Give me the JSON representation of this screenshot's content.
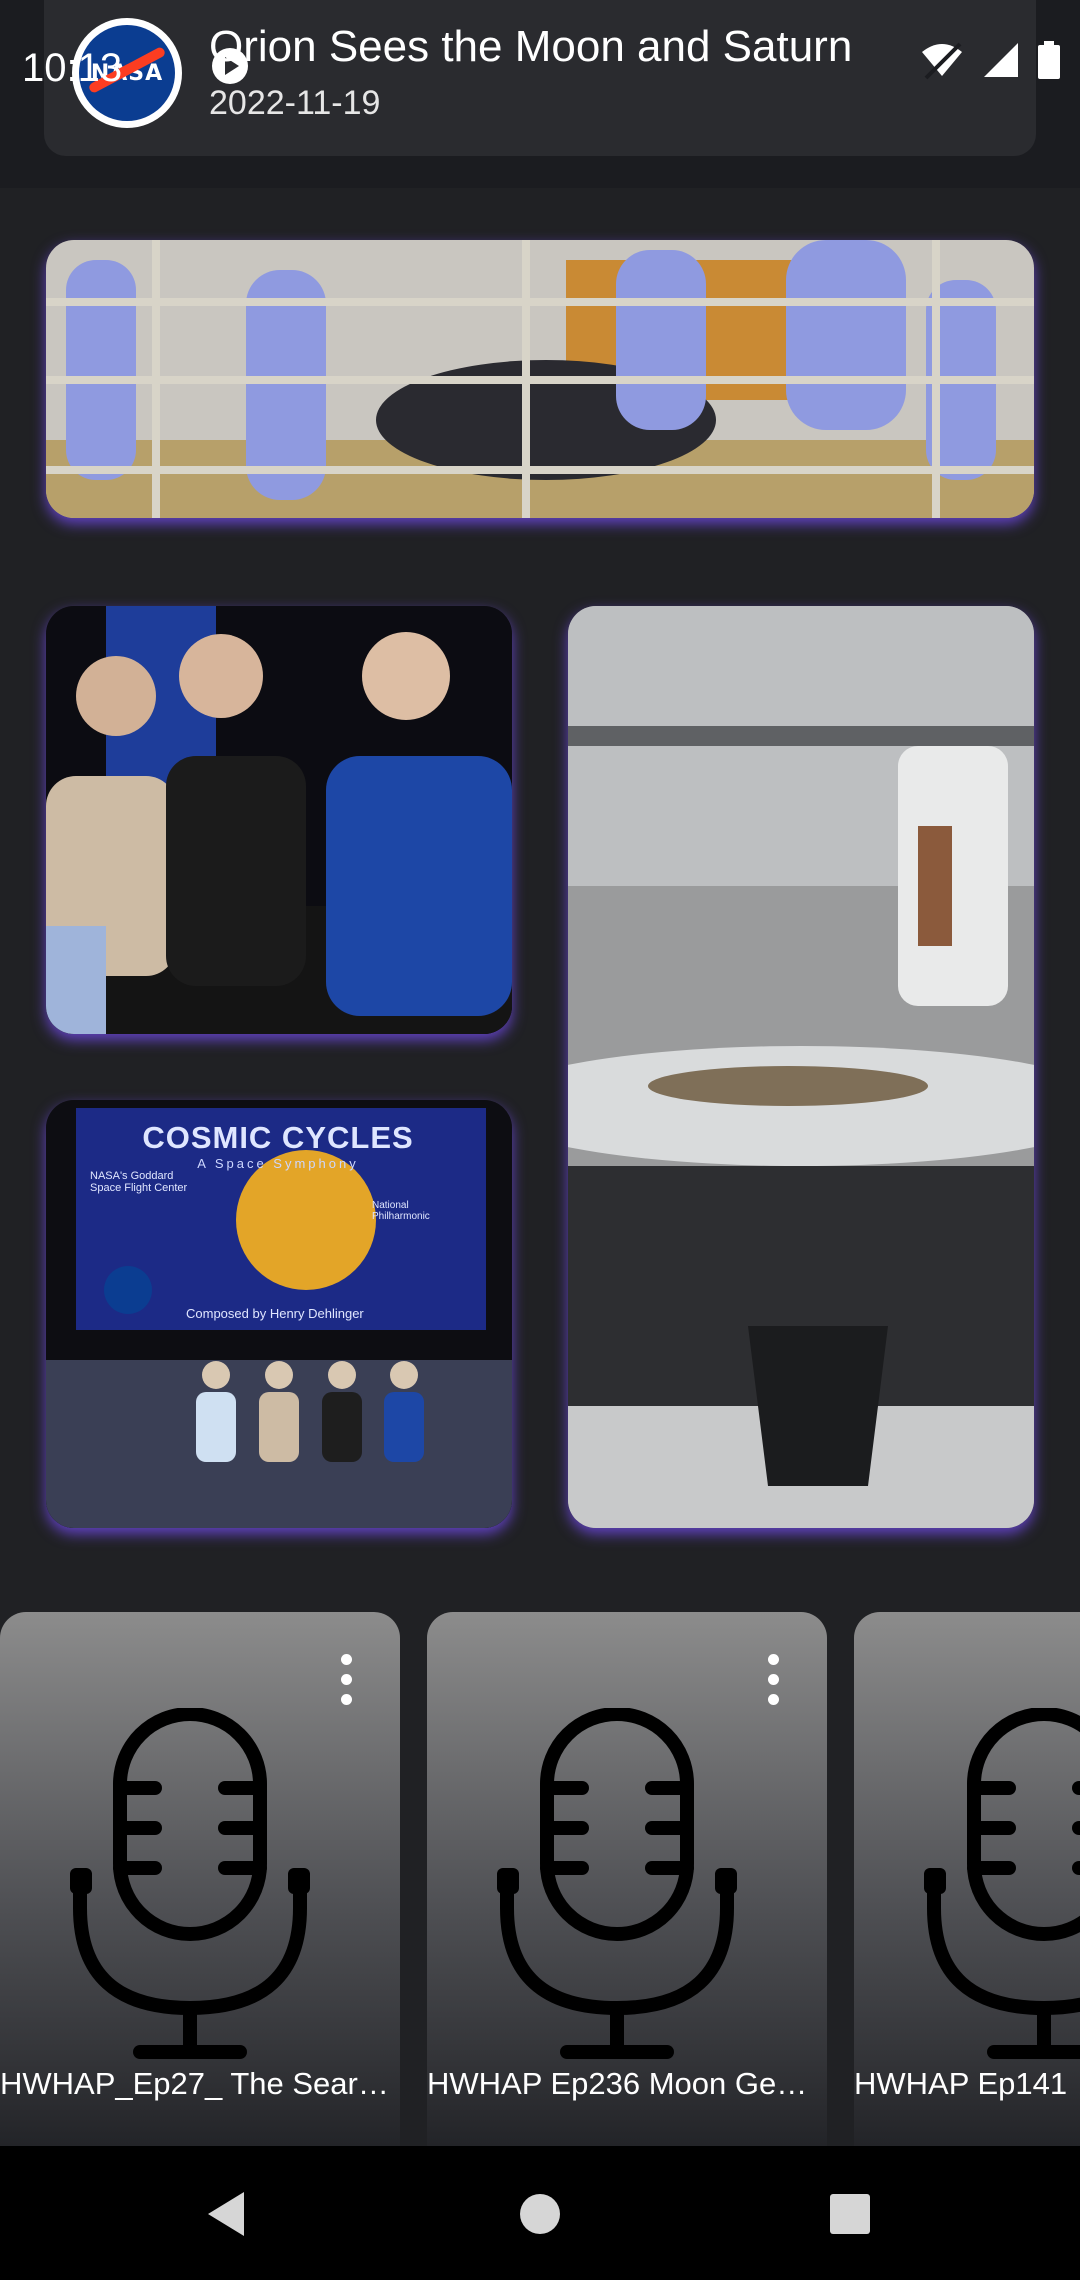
{
  "status_bar": {
    "time": "10:13"
  },
  "now_playing": {
    "logo": "NASA",
    "title": "Orion Sees the Moon and Saturn",
    "date": "2022-11-19"
  },
  "gallery": {
    "items": [
      {
        "name": "cleanroom-spacecraft-photo"
      },
      {
        "name": "panel-speakers-photo"
      },
      {
        "name": "instrument-closeup-photo"
      },
      {
        "name": "cosmic-cycles-stage-photo",
        "screen_title": "COSMIC CYCLES",
        "screen_subtitle": "A Space Symphony",
        "screen_left": "NASA's Goddard Space Flight Center",
        "screen_right": "National Philharmonic",
        "screen_credit": "Composed by Henry Dehlinger"
      }
    ]
  },
  "podcasts": [
    {
      "label": "HWHAP_Ep27_ The Sear…"
    },
    {
      "label": "HWHAP Ep236 Moon Ge…"
    },
    {
      "label": "HWHAP Ep141"
    }
  ],
  "colors": {
    "accent_glow": "#6c48dc",
    "background": "#202124"
  },
  "icons": [
    "wifi-icon",
    "signal-icon",
    "battery-icon",
    "play-icon",
    "more-vert-icon",
    "microphone-icon",
    "back-icon",
    "home-icon",
    "recents-icon"
  ]
}
